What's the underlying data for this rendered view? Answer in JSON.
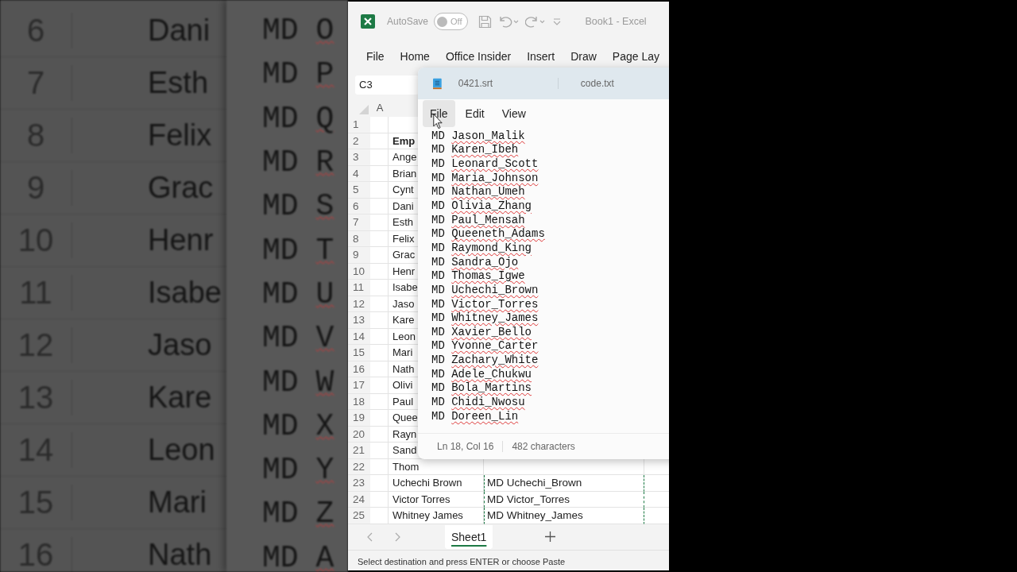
{
  "backdrop": {
    "sheet_rows": [
      {
        "number": "6",
        "name": "Dani"
      },
      {
        "number": "7",
        "name": "Esth"
      },
      {
        "number": "8",
        "name": "Felix"
      },
      {
        "number": "9",
        "name": "Grac"
      },
      {
        "number": "10",
        "name": "Henr"
      },
      {
        "number": "11",
        "name": "Isabe"
      },
      {
        "number": "12",
        "name": "Jaso"
      },
      {
        "number": "13",
        "name": "Kare"
      },
      {
        "number": "14",
        "name": "Leon"
      },
      {
        "number": "15",
        "name": "Mari"
      },
      {
        "number": "16",
        "name": "Nath"
      }
    ],
    "text_lines": [
      {
        "prefix": "MD",
        "name": "O"
      },
      {
        "prefix": "MD",
        "name": "P"
      },
      {
        "prefix": "MD",
        "name": "Q"
      },
      {
        "prefix": "MD",
        "name": "R"
      },
      {
        "prefix": "MD",
        "name": "S"
      },
      {
        "prefix": "MD",
        "name": "T"
      },
      {
        "prefix": "MD",
        "name": "U"
      },
      {
        "prefix": "MD",
        "name": "V"
      },
      {
        "prefix": "MD",
        "name": "W"
      },
      {
        "prefix": "MD",
        "name": "X"
      },
      {
        "prefix": "MD",
        "name": "Y"
      },
      {
        "prefix": "MD",
        "name": "Z"
      },
      {
        "prefix": "MD",
        "name": "A"
      }
    ]
  },
  "excel": {
    "title_bar": {
      "autosave_label": "AutoSave",
      "autosave": {
        "on": false,
        "label": "Off"
      },
      "title": "Book1  -  Excel"
    },
    "ribbon_tabs": [
      "File",
      "Home",
      "Office Insider",
      "Insert",
      "Draw",
      "Page Lay"
    ],
    "copy_marquee": true,
    "name_box": "C3",
    "column_headers": [
      "A"
    ],
    "rows": [
      {
        "number": "1"
      },
      {
        "number": "2",
        "name": "Emp",
        "kind": "header"
      },
      {
        "number": "3",
        "name": "Ange"
      },
      {
        "number": "4",
        "name": "Brian"
      },
      {
        "number": "5",
        "name": "Cynt"
      },
      {
        "number": "6",
        "name": "Dani"
      },
      {
        "number": "7",
        "name": "Esth"
      },
      {
        "number": "8",
        "name": "Felix"
      },
      {
        "number": "9",
        "name": "Grac"
      },
      {
        "number": "10",
        "name": "Henr"
      },
      {
        "number": "11",
        "name": "Isabe"
      },
      {
        "number": "12",
        "name": "Jaso"
      },
      {
        "number": "13",
        "name": "Kare"
      },
      {
        "number": "14",
        "name": "Leon"
      },
      {
        "number": "15",
        "name": "Mari"
      },
      {
        "number": "16",
        "name": "Nath"
      },
      {
        "number": "17",
        "name": "Olivi"
      },
      {
        "number": "18",
        "name": "Paul"
      },
      {
        "number": "19",
        "name": "Quee"
      },
      {
        "number": "20",
        "name": "Rayn"
      },
      {
        "number": "21",
        "name": "Sand"
      },
      {
        "number": "22",
        "name": "Thom"
      },
      {
        "number": "23",
        "name": "Uchechi Brown",
        "code": "MD Uchechi_Brown"
      },
      {
        "number": "24",
        "name": "Victor Torres",
        "code": "MD Victor_Torres"
      },
      {
        "number": "25",
        "name": "Whitney James",
        "code": "MD Whitney_James"
      }
    ],
    "sheet_tabs": [
      {
        "label": "Sheet1",
        "selected": true
      }
    ],
    "status": "Select destination and press ENTER or choose Paste"
  },
  "notepad": {
    "tabs": [
      "0421.srt",
      "code.txt"
    ],
    "menu": [
      {
        "label": "File",
        "hovered": true
      },
      {
        "label": "Edit",
        "hovered": false
      },
      {
        "label": "View",
        "hovered": false
      }
    ],
    "lines": [
      {
        "prefix": "MD",
        "name": "Jason_Malik"
      },
      {
        "prefix": "MD",
        "name": "Karen_Ibeh"
      },
      {
        "prefix": "MD",
        "name": "Leonard_Scott"
      },
      {
        "prefix": "MD",
        "name": "Maria_Johnson"
      },
      {
        "prefix": "MD",
        "name": "Nathan_Umeh"
      },
      {
        "prefix": "MD",
        "name": "Olivia_Zhang"
      },
      {
        "prefix": "MD",
        "name": "Paul_Mensah"
      },
      {
        "prefix": "MD",
        "name": "Queeneth_Adams"
      },
      {
        "prefix": "MD",
        "name": "Raymond_King"
      },
      {
        "prefix": "MD",
        "name": "Sandra_Ojo"
      },
      {
        "prefix": "MD",
        "name": "Thomas_Igwe"
      },
      {
        "prefix": "MD",
        "name": "Uchechi_Brown"
      },
      {
        "prefix": "MD",
        "name": "Victor_Torres"
      },
      {
        "prefix": "MD",
        "name": "Whitney_James"
      },
      {
        "prefix": "MD",
        "name": "Xavier_Bello"
      },
      {
        "prefix": "MD",
        "name": "Yvonne_Carter"
      },
      {
        "prefix": "MD",
        "name": "Zachary_White"
      },
      {
        "prefix": "MD",
        "name": "Adele_Chukwu"
      },
      {
        "prefix": "MD",
        "name": "Bola_Martins"
      },
      {
        "prefix": "MD",
        "name": "Chidi_Nwosu"
      },
      {
        "prefix": "MD",
        "name": "Doreen_Lin"
      }
    ],
    "status": {
      "position": "Ln 18, Col 16",
      "count": "482 characters"
    }
  }
}
